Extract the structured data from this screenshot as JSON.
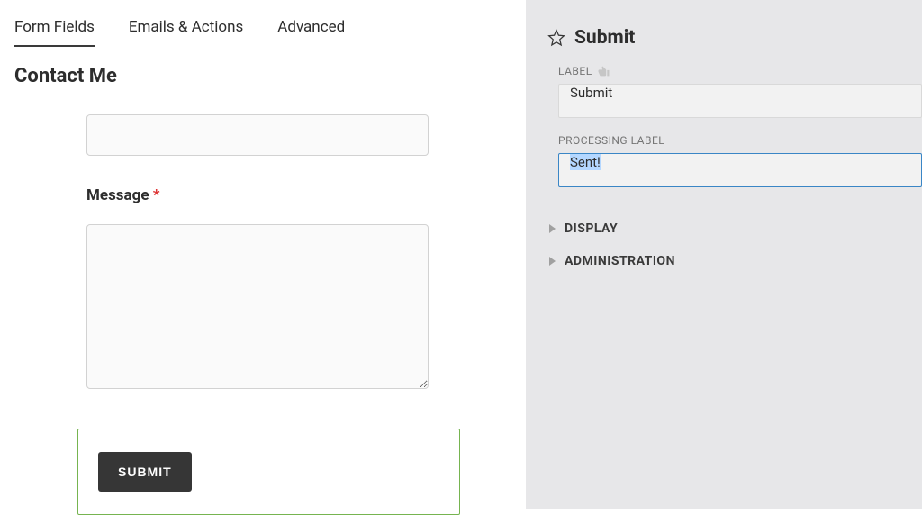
{
  "tabs": [
    {
      "label": "Form Fields",
      "active": true
    },
    {
      "label": "Emails & Actions",
      "active": false
    },
    {
      "label": "Advanced",
      "active": false
    }
  ],
  "form": {
    "title": "Contact Me",
    "message_label": "Message",
    "message_required": "*",
    "submit_button_label": "SUBMIT"
  },
  "panel": {
    "title": "Submit",
    "label_field": {
      "label": "LABEL",
      "value": "Submit"
    },
    "processing_field": {
      "label": "PROCESSING LABEL",
      "value": "Sent!"
    },
    "sections": [
      {
        "label": "DISPLAY"
      },
      {
        "label": "ADMINISTRATION"
      }
    ]
  }
}
